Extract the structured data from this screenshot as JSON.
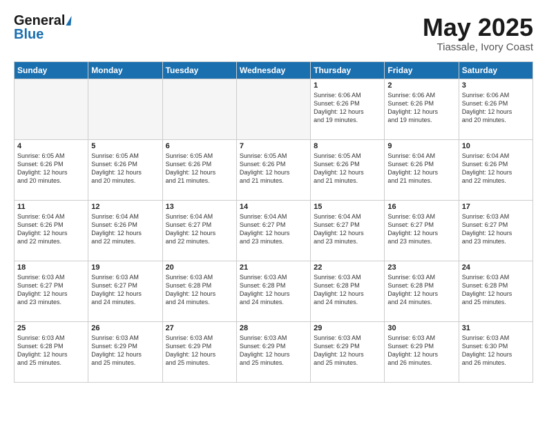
{
  "header": {
    "logo_general": "General",
    "logo_blue": "Blue",
    "month": "May 2025",
    "location": "Tiassale, Ivory Coast"
  },
  "days_of_week": [
    "Sunday",
    "Monday",
    "Tuesday",
    "Wednesday",
    "Thursday",
    "Friday",
    "Saturday"
  ],
  "weeks": [
    [
      {
        "day": "",
        "info": ""
      },
      {
        "day": "",
        "info": ""
      },
      {
        "day": "",
        "info": ""
      },
      {
        "day": "",
        "info": ""
      },
      {
        "day": "1",
        "info": "Sunrise: 6:06 AM\nSunset: 6:26 PM\nDaylight: 12 hours\nand 19 minutes."
      },
      {
        "day": "2",
        "info": "Sunrise: 6:06 AM\nSunset: 6:26 PM\nDaylight: 12 hours\nand 19 minutes."
      },
      {
        "day": "3",
        "info": "Sunrise: 6:06 AM\nSunset: 6:26 PM\nDaylight: 12 hours\nand 20 minutes."
      }
    ],
    [
      {
        "day": "4",
        "info": "Sunrise: 6:05 AM\nSunset: 6:26 PM\nDaylight: 12 hours\nand 20 minutes."
      },
      {
        "day": "5",
        "info": "Sunrise: 6:05 AM\nSunset: 6:26 PM\nDaylight: 12 hours\nand 20 minutes."
      },
      {
        "day": "6",
        "info": "Sunrise: 6:05 AM\nSunset: 6:26 PM\nDaylight: 12 hours\nand 21 minutes."
      },
      {
        "day": "7",
        "info": "Sunrise: 6:05 AM\nSunset: 6:26 PM\nDaylight: 12 hours\nand 21 minutes."
      },
      {
        "day": "8",
        "info": "Sunrise: 6:05 AM\nSunset: 6:26 PM\nDaylight: 12 hours\nand 21 minutes."
      },
      {
        "day": "9",
        "info": "Sunrise: 6:04 AM\nSunset: 6:26 PM\nDaylight: 12 hours\nand 21 minutes."
      },
      {
        "day": "10",
        "info": "Sunrise: 6:04 AM\nSunset: 6:26 PM\nDaylight: 12 hours\nand 22 minutes."
      }
    ],
    [
      {
        "day": "11",
        "info": "Sunrise: 6:04 AM\nSunset: 6:26 PM\nDaylight: 12 hours\nand 22 minutes."
      },
      {
        "day": "12",
        "info": "Sunrise: 6:04 AM\nSunset: 6:26 PM\nDaylight: 12 hours\nand 22 minutes."
      },
      {
        "day": "13",
        "info": "Sunrise: 6:04 AM\nSunset: 6:27 PM\nDaylight: 12 hours\nand 22 minutes."
      },
      {
        "day": "14",
        "info": "Sunrise: 6:04 AM\nSunset: 6:27 PM\nDaylight: 12 hours\nand 23 minutes."
      },
      {
        "day": "15",
        "info": "Sunrise: 6:04 AM\nSunset: 6:27 PM\nDaylight: 12 hours\nand 23 minutes."
      },
      {
        "day": "16",
        "info": "Sunrise: 6:03 AM\nSunset: 6:27 PM\nDaylight: 12 hours\nand 23 minutes."
      },
      {
        "day": "17",
        "info": "Sunrise: 6:03 AM\nSunset: 6:27 PM\nDaylight: 12 hours\nand 23 minutes."
      }
    ],
    [
      {
        "day": "18",
        "info": "Sunrise: 6:03 AM\nSunset: 6:27 PM\nDaylight: 12 hours\nand 23 minutes."
      },
      {
        "day": "19",
        "info": "Sunrise: 6:03 AM\nSunset: 6:27 PM\nDaylight: 12 hours\nand 24 minutes."
      },
      {
        "day": "20",
        "info": "Sunrise: 6:03 AM\nSunset: 6:28 PM\nDaylight: 12 hours\nand 24 minutes."
      },
      {
        "day": "21",
        "info": "Sunrise: 6:03 AM\nSunset: 6:28 PM\nDaylight: 12 hours\nand 24 minutes."
      },
      {
        "day": "22",
        "info": "Sunrise: 6:03 AM\nSunset: 6:28 PM\nDaylight: 12 hours\nand 24 minutes."
      },
      {
        "day": "23",
        "info": "Sunrise: 6:03 AM\nSunset: 6:28 PM\nDaylight: 12 hours\nand 24 minutes."
      },
      {
        "day": "24",
        "info": "Sunrise: 6:03 AM\nSunset: 6:28 PM\nDaylight: 12 hours\nand 25 minutes."
      }
    ],
    [
      {
        "day": "25",
        "info": "Sunrise: 6:03 AM\nSunset: 6:28 PM\nDaylight: 12 hours\nand 25 minutes."
      },
      {
        "day": "26",
        "info": "Sunrise: 6:03 AM\nSunset: 6:29 PM\nDaylight: 12 hours\nand 25 minutes."
      },
      {
        "day": "27",
        "info": "Sunrise: 6:03 AM\nSunset: 6:29 PM\nDaylight: 12 hours\nand 25 minutes."
      },
      {
        "day": "28",
        "info": "Sunrise: 6:03 AM\nSunset: 6:29 PM\nDaylight: 12 hours\nand 25 minutes."
      },
      {
        "day": "29",
        "info": "Sunrise: 6:03 AM\nSunset: 6:29 PM\nDaylight: 12 hours\nand 25 minutes."
      },
      {
        "day": "30",
        "info": "Sunrise: 6:03 AM\nSunset: 6:29 PM\nDaylight: 12 hours\nand 26 minutes."
      },
      {
        "day": "31",
        "info": "Sunrise: 6:03 AM\nSunset: 6:30 PM\nDaylight: 12 hours\nand 26 minutes."
      }
    ]
  ]
}
